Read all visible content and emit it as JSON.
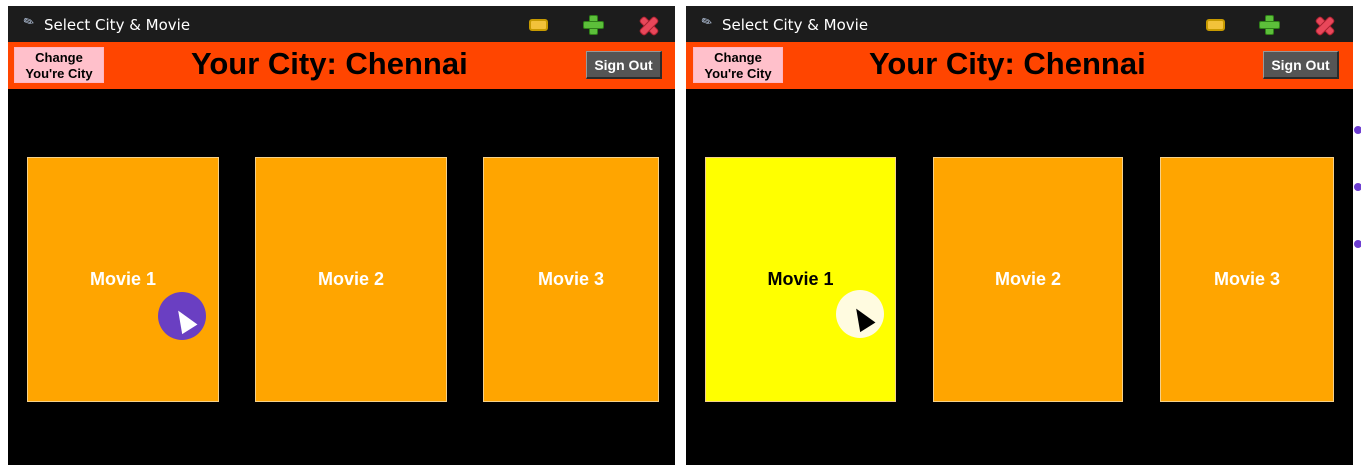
{
  "panels": [
    {
      "id": "before",
      "window_title": "Select City & Movie",
      "change_city_line1": "Change",
      "change_city_line2": "You're City",
      "city_title": "Your City: Chennai",
      "sign_out_label": "Sign Out",
      "movies": [
        "Movie 1",
        "Movie 2",
        "Movie 3"
      ],
      "hovered_movie": null,
      "cursor_halo_color": "#6a3fc2"
    },
    {
      "id": "after",
      "window_title": "Select City & Movie",
      "change_city_line1": "Change",
      "change_city_line2": "You're City",
      "city_title": "Your City: Chennai",
      "sign_out_label": "Sign Out",
      "movies": [
        "Movie 1",
        "Movie 2",
        "Movie 3"
      ],
      "hovered_movie": "Movie 1",
      "cursor_halo_color": "#fffbe0"
    }
  ],
  "colors": {
    "titlebar": "#1c1c1c",
    "header": "#ff4500",
    "window_body": "#000000",
    "change_button": "#ffc0cb",
    "sign_out_button": "#555555",
    "movie_card": "#ffa500",
    "movie_card_hover": "#ffff00"
  },
  "icons": {
    "app": "feather-icon",
    "minimize": "minimize-icon",
    "maximize": "maximize-icon",
    "close": "close-icon",
    "cursor": "mouse-pointer-icon"
  }
}
